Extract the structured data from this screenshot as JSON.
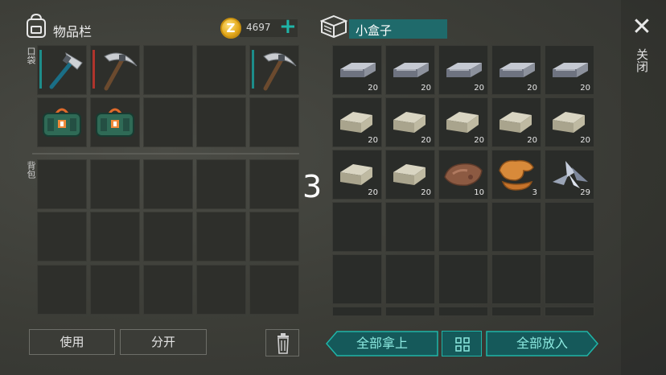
{
  "inventory": {
    "title": "物品栏",
    "pocket_label": "口袋",
    "backpack_label": "背包",
    "coins": "4697",
    "coin_symbol": "Z",
    "plus_symbol": "+",
    "pocket_slots": [
      {
        "item": "hatchet-icon",
        "bar": "#1d8d8a"
      },
      {
        "item": "pickaxe-icon",
        "bar": "#b0342c"
      },
      {
        "item": null
      },
      {
        "item": null
      },
      {
        "item": "pickaxe-icon",
        "bar": "#1d8d8a"
      },
      {
        "item": "medkit-icon"
      },
      {
        "item": "medkit-icon"
      },
      {
        "item": null
      },
      {
        "item": null
      },
      {
        "item": null
      }
    ]
  },
  "container": {
    "title": "小盒子",
    "slots": [
      {
        "item": "iron-ingot-icon",
        "qty": "20"
      },
      {
        "item": "iron-ingot-icon",
        "qty": "20"
      },
      {
        "item": "iron-ingot-icon",
        "qty": "20"
      },
      {
        "item": "iron-ingot-icon",
        "qty": "20"
      },
      {
        "item": "iron-ingot-icon",
        "qty": "20"
      },
      {
        "item": "stone-block-icon",
        "qty": "20"
      },
      {
        "item": "stone-block-icon",
        "qty": "20"
      },
      {
        "item": "stone-block-icon",
        "qty": "20"
      },
      {
        "item": "stone-block-icon",
        "qty": "20"
      },
      {
        "item": "stone-block-icon",
        "qty": "20"
      },
      {
        "item": "stone-block-icon",
        "qty": "20"
      },
      {
        "item": "stone-block-icon",
        "qty": "20"
      },
      {
        "item": "ore-icon",
        "qty": "10"
      },
      {
        "item": "leather-icon",
        "qty": "3"
      },
      {
        "item": "metal-scrap-icon",
        "qty": "29"
      }
    ]
  },
  "overlay_number": "3",
  "close_label": "关闭",
  "buttons": {
    "use": "使用",
    "split": "分开",
    "take_all": "全部拿上",
    "put_all": "全部放入"
  },
  "colors": {
    "accent": "#1fb5a8",
    "title_bg": "#1f6a6b",
    "gold": "#e3a91d"
  }
}
